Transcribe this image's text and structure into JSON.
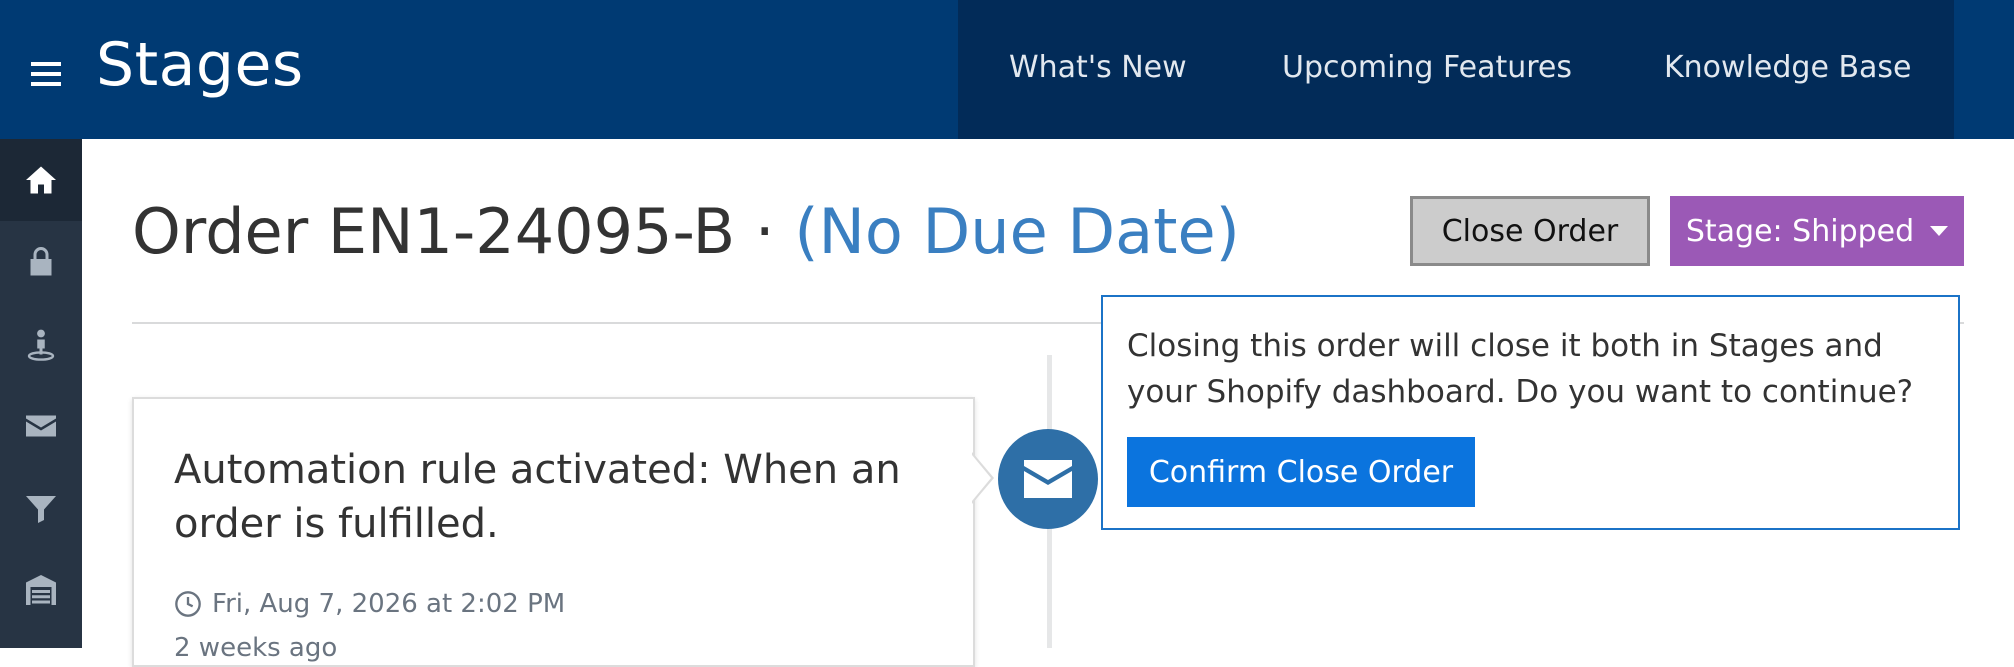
{
  "header": {
    "brand": "Stages",
    "nav": [
      {
        "label": "What's New"
      },
      {
        "label": "Upcoming Features"
      },
      {
        "label": "Knowledge Base"
      }
    ]
  },
  "sidebar": {
    "items": [
      {
        "icon": "home-icon",
        "active": true
      },
      {
        "icon": "lock-icon"
      },
      {
        "icon": "person-pin-icon"
      },
      {
        "icon": "envelope-icon"
      },
      {
        "icon": "filter-icon"
      },
      {
        "icon": "warehouse-icon"
      }
    ]
  },
  "order": {
    "title": "Order EN1-24095-B · ",
    "due": "(No Due Date)"
  },
  "actions": {
    "close_label": "Close Order",
    "stage_label": "Stage: Shipped"
  },
  "popover": {
    "text": "Closing this order will close it both in Stages and your Shopify dashboard. Do you want to continue?",
    "confirm_label": "Confirm Close Order"
  },
  "timeline": {
    "event_title": "Automation rule activated: When an order is fulfilled.",
    "event_time": "Fri, Aug 7, 2026 at 2:02 PM",
    "event_ago": "2 weeks ago"
  },
  "colors": {
    "topbar": "#003a73",
    "nav_group": "#022b58",
    "sidebar": "#273444",
    "stage_button": "#9b59b6",
    "confirm_button": "#0b74de",
    "due_text": "#3a7fc1",
    "timeline_icon": "#2e6fa7"
  }
}
